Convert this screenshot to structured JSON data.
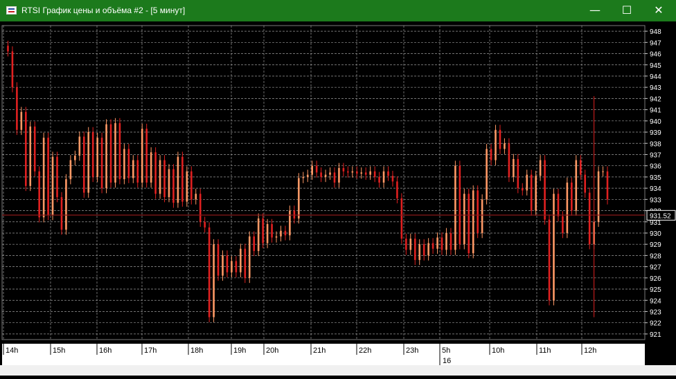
{
  "window": {
    "title": "RTSI График цены и объёма #2 - [5 минут]",
    "minimize_icon": "minimize-icon",
    "maximize_icon": "maximize-icon",
    "close_icon": "close-icon"
  },
  "colors": {
    "titlebar": "#1c7a1c",
    "background": "#000000",
    "grid": "#9a9a9a",
    "candles": "#e02020",
    "candles_light": "#ff9966",
    "price_line": "#8b1a1a"
  },
  "chart_data": {
    "type": "candlestick",
    "ylim": [
      920.5,
      948.5
    ],
    "y_ticks": [
      948,
      947,
      946,
      945,
      944,
      943,
      942,
      941,
      940,
      939,
      938,
      937,
      936,
      935,
      934,
      933,
      932,
      931,
      930,
      929,
      928,
      927,
      926,
      925,
      924,
      923,
      922,
      921
    ],
    "current_price_label": "931.52",
    "current_price": 931.52,
    "time_labels": [
      "14h",
      "15h",
      "16h",
      "17h",
      "18h",
      "19h",
      "20h",
      "21h",
      "22h",
      "23h",
      "5h",
      "10h",
      "11h",
      "12h"
    ],
    "date_label": "16",
    "grid": true,
    "price_path": [
      [
        0,
        946.7
      ],
      [
        3,
        946.2
      ],
      [
        6,
        943
      ],
      [
        9,
        939.2
      ],
      [
        12,
        940.8
      ],
      [
        15,
        934.2
      ],
      [
        18,
        939.5
      ],
      [
        21,
        935.5
      ],
      [
        24,
        931.4
      ],
      [
        27,
        938.5
      ],
      [
        30,
        931.6
      ],
      [
        33,
        936.8
      ],
      [
        36,
        933.2
      ],
      [
        39,
        930.3
      ],
      [
        42,
        934.8
      ],
      [
        45,
        936.5
      ],
      [
        48,
        936.9
      ],
      [
        51,
        938.6
      ],
      [
        54,
        933.6
      ],
      [
        57,
        939.0
      ],
      [
        60,
        935.0
      ],
      [
        63,
        938.5
      ],
      [
        66,
        934.0
      ],
      [
        69,
        939.7
      ],
      [
        72,
        934.5
      ],
      [
        75,
        939.8
      ],
      [
        78,
        934.8
      ],
      [
        81,
        937.5
      ],
      [
        84,
        934.9
      ],
      [
        87,
        936.5
      ],
      [
        90,
        934.5
      ],
      [
        93,
        939.3
      ],
      [
        96,
        934.5
      ],
      [
        99,
        937.2
      ],
      [
        102,
        933.5
      ],
      [
        105,
        936.5
      ],
      [
        108,
        933.2
      ],
      [
        111,
        935.7
      ],
      [
        114,
        932.7
      ],
      [
        117,
        936.8
      ],
      [
        120,
        932.8
      ],
      [
        123,
        935.5
      ],
      [
        126,
        933.0
      ],
      [
        129,
        933.5
      ],
      [
        132,
        931.0
      ],
      [
        135,
        930.5
      ],
      [
        138,
        922.5
      ],
      [
        141,
        929.0
      ],
      [
        144,
        926.2
      ],
      [
        147,
        928.0
      ],
      [
        150,
        926.5
      ],
      [
        153,
        927.5
      ],
      [
        156,
        926.5
      ],
      [
        159,
        928.6
      ],
      [
        162,
        926.0
      ],
      [
        165,
        929.7
      ],
      [
        168,
        928.4
      ],
      [
        171,
        931.3
      ],
      [
        174,
        929.1
      ],
      [
        177,
        930.8
      ],
      [
        180,
        929.6
      ],
      [
        183,
        929.7
      ],
      [
        186,
        930.2
      ],
      [
        189,
        929.8
      ],
      [
        192,
        932.0
      ],
      [
        195,
        931.3
      ],
      [
        198,
        934.9
      ],
      [
        201,
        935.0
      ],
      [
        204,
        935.2
      ],
      [
        207,
        936.0
      ],
      [
        210,
        935.4
      ],
      [
        213,
        935.0
      ],
      [
        216,
        935.2
      ],
      [
        219,
        935.4
      ],
      [
        222,
        934.5
      ],
      [
        225,
        935.8
      ],
      [
        228,
        935.5
      ],
      [
        231,
        935.4
      ],
      [
        234,
        935.5
      ],
      [
        237,
        935.3
      ],
      [
        240,
        935.4
      ],
      [
        243,
        935.2
      ],
      [
        246,
        935.5
      ],
      [
        249,
        935.0
      ],
      [
        252,
        934.5
      ],
      [
        255,
        935.5
      ],
      [
        258,
        935.1
      ],
      [
        261,
        934.6
      ],
      [
        264,
        933.1
      ],
      [
        267,
        929.5
      ],
      [
        270,
        928.5
      ],
      [
        273,
        929.5
      ],
      [
        276,
        927.6
      ],
      [
        279,
        929.0
      ],
      [
        282,
        928.0
      ],
      [
        285,
        929.1
      ],
      [
        288,
        928.6
      ],
      [
        291,
        929.6
      ],
      [
        294,
        928.5
      ],
      [
        297,
        930.0
      ],
      [
        300,
        928.5
      ],
      [
        303,
        936.0
      ],
      [
        306,
        929.0
      ],
      [
        309,
        933.5
      ],
      [
        312,
        928.2
      ],
      [
        315,
        933.8
      ],
      [
        318,
        930.0
      ],
      [
        321,
        933.0
      ],
      [
        324,
        937.5
      ],
      [
        327,
        936.5
      ],
      [
        330,
        939.2
      ],
      [
        333,
        937.5
      ],
      [
        336,
        938.0
      ],
      [
        339,
        935.0
      ],
      [
        342,
        936.6
      ],
      [
        345,
        934.0
      ],
      [
        348,
        933.8
      ],
      [
        351,
        935.2
      ],
      [
        354,
        932.0
      ],
      [
        357,
        935.1
      ],
      [
        360,
        936.5
      ],
      [
        363,
        931.2
      ],
      [
        366,
        924.0
      ],
      [
        369,
        933.5
      ],
      [
        372,
        931.5
      ],
      [
        375,
        930.0
      ],
      [
        378,
        934.5
      ],
      [
        381,
        932.0
      ],
      [
        384,
        936.5
      ],
      [
        387,
        935.2
      ],
      [
        390,
        933.6
      ],
      [
        393,
        929.0
      ],
      [
        396,
        931.0
      ],
      [
        399,
        935.5
      ],
      [
        402,
        935.5
      ],
      [
        405,
        933.0
      ]
    ],
    "horizontal_line": 931.6
  }
}
